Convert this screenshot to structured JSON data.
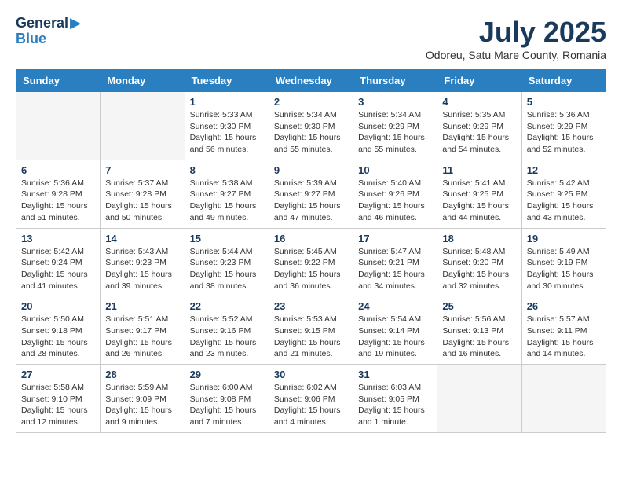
{
  "header": {
    "logo_line1": "General",
    "logo_line2": "Blue",
    "month": "July 2025",
    "location": "Odoreu, Satu Mare County, Romania"
  },
  "days_of_week": [
    "Sunday",
    "Monday",
    "Tuesday",
    "Wednesday",
    "Thursday",
    "Friday",
    "Saturday"
  ],
  "weeks": [
    [
      {
        "day": "",
        "info": ""
      },
      {
        "day": "",
        "info": ""
      },
      {
        "day": "1",
        "info": "Sunrise: 5:33 AM\nSunset: 9:30 PM\nDaylight: 15 hours and 56 minutes."
      },
      {
        "day": "2",
        "info": "Sunrise: 5:34 AM\nSunset: 9:30 PM\nDaylight: 15 hours and 55 minutes."
      },
      {
        "day": "3",
        "info": "Sunrise: 5:34 AM\nSunset: 9:29 PM\nDaylight: 15 hours and 55 minutes."
      },
      {
        "day": "4",
        "info": "Sunrise: 5:35 AM\nSunset: 9:29 PM\nDaylight: 15 hours and 54 minutes."
      },
      {
        "day": "5",
        "info": "Sunrise: 5:36 AM\nSunset: 9:29 PM\nDaylight: 15 hours and 52 minutes."
      }
    ],
    [
      {
        "day": "6",
        "info": "Sunrise: 5:36 AM\nSunset: 9:28 PM\nDaylight: 15 hours and 51 minutes."
      },
      {
        "day": "7",
        "info": "Sunrise: 5:37 AM\nSunset: 9:28 PM\nDaylight: 15 hours and 50 minutes."
      },
      {
        "day": "8",
        "info": "Sunrise: 5:38 AM\nSunset: 9:27 PM\nDaylight: 15 hours and 49 minutes."
      },
      {
        "day": "9",
        "info": "Sunrise: 5:39 AM\nSunset: 9:27 PM\nDaylight: 15 hours and 47 minutes."
      },
      {
        "day": "10",
        "info": "Sunrise: 5:40 AM\nSunset: 9:26 PM\nDaylight: 15 hours and 46 minutes."
      },
      {
        "day": "11",
        "info": "Sunrise: 5:41 AM\nSunset: 9:25 PM\nDaylight: 15 hours and 44 minutes."
      },
      {
        "day": "12",
        "info": "Sunrise: 5:42 AM\nSunset: 9:25 PM\nDaylight: 15 hours and 43 minutes."
      }
    ],
    [
      {
        "day": "13",
        "info": "Sunrise: 5:42 AM\nSunset: 9:24 PM\nDaylight: 15 hours and 41 minutes."
      },
      {
        "day": "14",
        "info": "Sunrise: 5:43 AM\nSunset: 9:23 PM\nDaylight: 15 hours and 39 minutes."
      },
      {
        "day": "15",
        "info": "Sunrise: 5:44 AM\nSunset: 9:23 PM\nDaylight: 15 hours and 38 minutes."
      },
      {
        "day": "16",
        "info": "Sunrise: 5:45 AM\nSunset: 9:22 PM\nDaylight: 15 hours and 36 minutes."
      },
      {
        "day": "17",
        "info": "Sunrise: 5:47 AM\nSunset: 9:21 PM\nDaylight: 15 hours and 34 minutes."
      },
      {
        "day": "18",
        "info": "Sunrise: 5:48 AM\nSunset: 9:20 PM\nDaylight: 15 hours and 32 minutes."
      },
      {
        "day": "19",
        "info": "Sunrise: 5:49 AM\nSunset: 9:19 PM\nDaylight: 15 hours and 30 minutes."
      }
    ],
    [
      {
        "day": "20",
        "info": "Sunrise: 5:50 AM\nSunset: 9:18 PM\nDaylight: 15 hours and 28 minutes."
      },
      {
        "day": "21",
        "info": "Sunrise: 5:51 AM\nSunset: 9:17 PM\nDaylight: 15 hours and 26 minutes."
      },
      {
        "day": "22",
        "info": "Sunrise: 5:52 AM\nSunset: 9:16 PM\nDaylight: 15 hours and 23 minutes."
      },
      {
        "day": "23",
        "info": "Sunrise: 5:53 AM\nSunset: 9:15 PM\nDaylight: 15 hours and 21 minutes."
      },
      {
        "day": "24",
        "info": "Sunrise: 5:54 AM\nSunset: 9:14 PM\nDaylight: 15 hours and 19 minutes."
      },
      {
        "day": "25",
        "info": "Sunrise: 5:56 AM\nSunset: 9:13 PM\nDaylight: 15 hours and 16 minutes."
      },
      {
        "day": "26",
        "info": "Sunrise: 5:57 AM\nSunset: 9:11 PM\nDaylight: 15 hours and 14 minutes."
      }
    ],
    [
      {
        "day": "27",
        "info": "Sunrise: 5:58 AM\nSunset: 9:10 PM\nDaylight: 15 hours and 12 minutes."
      },
      {
        "day": "28",
        "info": "Sunrise: 5:59 AM\nSunset: 9:09 PM\nDaylight: 15 hours and 9 minutes."
      },
      {
        "day": "29",
        "info": "Sunrise: 6:00 AM\nSunset: 9:08 PM\nDaylight: 15 hours and 7 minutes."
      },
      {
        "day": "30",
        "info": "Sunrise: 6:02 AM\nSunset: 9:06 PM\nDaylight: 15 hours and 4 minutes."
      },
      {
        "day": "31",
        "info": "Sunrise: 6:03 AM\nSunset: 9:05 PM\nDaylight: 15 hours and 1 minute."
      },
      {
        "day": "",
        "info": ""
      },
      {
        "day": "",
        "info": ""
      }
    ]
  ]
}
